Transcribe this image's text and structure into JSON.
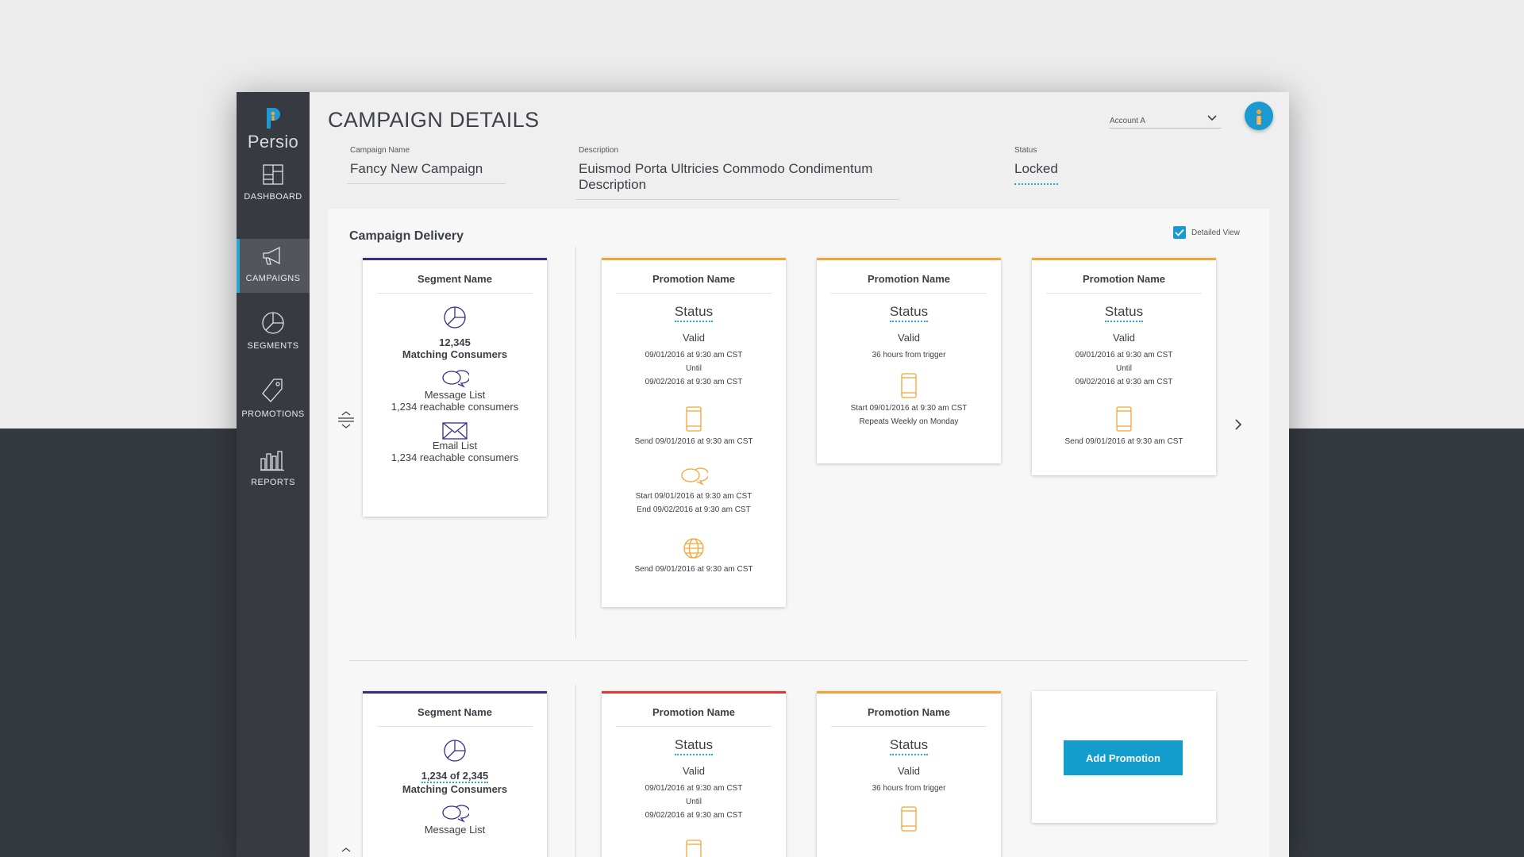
{
  "app": {
    "brand": "Persio",
    "page_title": "CAMPAIGN DETAILS",
    "account": "Account A"
  },
  "sidebar": {
    "items": [
      {
        "label": "DASHBOARD",
        "icon": "dashboard-icon"
      },
      {
        "label": "CAMPAIGNS",
        "icon": "megaphone-icon",
        "active": true
      },
      {
        "label": "SEGMENTS",
        "icon": "pie-chart-icon"
      },
      {
        "label": "PROMOTIONS",
        "icon": "tag-icon"
      },
      {
        "label": "REPORTS",
        "icon": "bar-chart-icon"
      }
    ]
  },
  "fields": {
    "campaign_name": {
      "label": "Campaign Name",
      "value": "Fancy New Campaign"
    },
    "description": {
      "label": "Description",
      "value": "Euismod Porta Ultricies Commodo Condimentum Description"
    },
    "status": {
      "label": "Status",
      "value": "Locked"
    }
  },
  "delivery": {
    "title": "Campaign Delivery",
    "detailed_view_label": "Detailed View",
    "detailed_view_checked": true,
    "row1": {
      "segment": {
        "name": "Segment Name",
        "count": "12,345",
        "count_label": "Matching Consumers",
        "message_list": "Message List",
        "message_reach": "1,234 reachable consumers",
        "email_list": "Email List",
        "email_reach": "1,234 reachable consumers"
      },
      "promos": [
        {
          "name": "Promotion Name",
          "status": "Status",
          "valid": "Valid",
          "range_start": "09/01/2016 at 9:30 am CST",
          "until": "Until",
          "range_end": "09/02/2016 at 9:30 am CST",
          "mobile_send": "Send 09/01/2016 at 9:30 am CST",
          "chat_start": "Start 09/01/2016 at 9:30 am CST",
          "chat_end": "End 09/02/2016 at 9:30 am CST",
          "web_send": "Send 09/01/2016 at 9:30 am CST"
        },
        {
          "name": "Promotion Name",
          "status": "Status",
          "valid": "Valid",
          "trigger": "36 hours from trigger",
          "mobile_start": "Start 09/01/2016 at 9:30 am CST",
          "repeats": "Repeats Weekly on Monday"
        },
        {
          "name": "Promotion Name",
          "status": "Status",
          "valid": "Valid",
          "range_start": "09/01/2016 at 9:30 am CST",
          "until": "Until",
          "range_end": "09/02/2016 at 9:30 am CST",
          "mobile_send": "Send 09/01/2016 at 9:30 am CST"
        }
      ]
    },
    "row2": {
      "segment": {
        "name": "Segment Name",
        "count": "1,234 of 2,345",
        "count_label": "Matching Consumers",
        "message_list": "Message List"
      },
      "promos": [
        {
          "name": "Promotion Name",
          "status": "Status",
          "valid": "Valid",
          "range_start": "09/01/2016 at 9:30 am CST",
          "until": "Until",
          "range_end": "09/02/2016 at 9:30 am CST"
        },
        {
          "name": "Promotion Name",
          "status": "Status",
          "valid": "Valid",
          "trigger": "36 hours from trigger"
        }
      ],
      "add_button": "Add Promotion"
    }
  },
  "colors": {
    "accent": "#1a9ad1",
    "segment_border": "#3a2a8c",
    "promo_border": "#f5a335",
    "promo_border_alert": "#e2382e",
    "sidebar": "#373b41"
  }
}
